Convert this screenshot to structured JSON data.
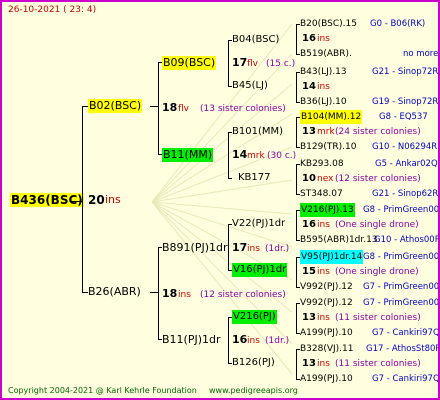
{
  "header": {
    "date": "26-10-2021 ( 23: 4)"
  },
  "footer": {
    "copyright": "Copyright 2004-2021 @ Karl Kehrle Foundation",
    "site": "www.pedigreeapis.org"
  },
  "root": {
    "id": "B436(BSC)",
    "gen": "20",
    "ins": "ins"
  },
  "gen1": [
    {
      "id": "B02(BSC)",
      "gen": "18",
      "ins": "flv",
      "note": "(13 sister colonies)"
    },
    {
      "id": "B26(ABR)",
      "gen": "18",
      "ins": "ins",
      "note": "(12 sister colonies)"
    }
  ],
  "gen2": [
    {
      "id": "B09(BSC)",
      "gen": "17",
      "ins": "flv",
      "note": "(15 c.)"
    },
    {
      "id": "B11(MM)",
      "gen": "14",
      "ins": "mrk",
      "note": "(30 c.)"
    },
    {
      "id": "B891(PJ)1dr",
      "gen": "17",
      "ins": "ins",
      "note": "(1dr.)"
    },
    {
      "id": "B11(PJ)1dr",
      "gen": "16",
      "ins": "ins",
      "note": "(1dr.)"
    }
  ],
  "gen3": [
    {
      "id": "B04(BSC)"
    },
    {
      "id": "B45(LJ)"
    },
    {
      "id": "B101(MM)"
    },
    {
      "id": "KB177"
    },
    {
      "id": "V22(PJ)1dr"
    },
    {
      "id": "V16(PJ)1dr"
    },
    {
      "id": "V216(PJ)"
    },
    {
      "id": "B126(PJ)"
    }
  ],
  "gen4": [
    {
      "sire": "B20(BSC).15",
      "sire_tag": "G0 - B06(RK)",
      "gen": "16",
      "ins": "ins",
      "note": "",
      "dam": "B519(ABR).",
      "dam_tag": "no more"
    },
    {
      "sire": "B43(LJ).13",
      "sire_tag": "G21 - Sinop72R",
      "gen": "14",
      "ins": "ins",
      "note": "",
      "dam": "B36(LJ).10",
      "dam_tag": "G19 - Sinop72R"
    },
    {
      "sire": "B104(MM).12",
      "sire_tag": "G8 - EQ537",
      "gen": "13",
      "ins": "mrk",
      "note": "(24 sister colonies)",
      "dam": "B129(TR).10",
      "dam_tag": "G10 - N06294R"
    },
    {
      "sire": "KB293.08",
      "sire_tag": "G5 - Ankar02Q",
      "gen": "10",
      "ins": "nex",
      "note": "(12 sister colonies)",
      "dam": "ST348.07",
      "dam_tag": "G21 - Sinop62R"
    },
    {
      "sire": "V216(PJ).13",
      "sire_tag": "G8 - PrimGreen00",
      "gen": "16",
      "ins": "ins",
      "note": "(One single drone)",
      "dam": "B595(ABR)1dr.13",
      "dam_tag": "G10 - Athos00R"
    },
    {
      "sire": "V95(PJ)1dr.14",
      "sire_tag": "G8 - PrimGreen00",
      "gen": "15",
      "ins": "ins",
      "note": "(One single drone)",
      "dam": "V992(PJ).12",
      "dam_tag": "G7 - PrimGreen00"
    },
    {
      "sire": "V992(PJ).12",
      "sire_tag": "G7 - PrimGreen00",
      "gen": "13",
      "ins": "ins",
      "note": "(11 sister colonies)",
      "dam": "A199(PJ).10",
      "dam_tag": "G7 - Cankiri97Q"
    },
    {
      "sire": "B328(VJ).11",
      "sire_tag": "G17 - AthosSt80R",
      "gen": "13",
      "ins": "ins",
      "note": "(11 sister colonies)",
      "dam": "A199(PJ).10",
      "dam_tag": "G7 - Cankiri97Q"
    }
  ],
  "colors": {
    "border": "#cc00cc",
    "background": "#ffffdf",
    "accent_red": "#cc0000",
    "tag_blue": "#0000cc",
    "note_purple": "#8800aa"
  }
}
